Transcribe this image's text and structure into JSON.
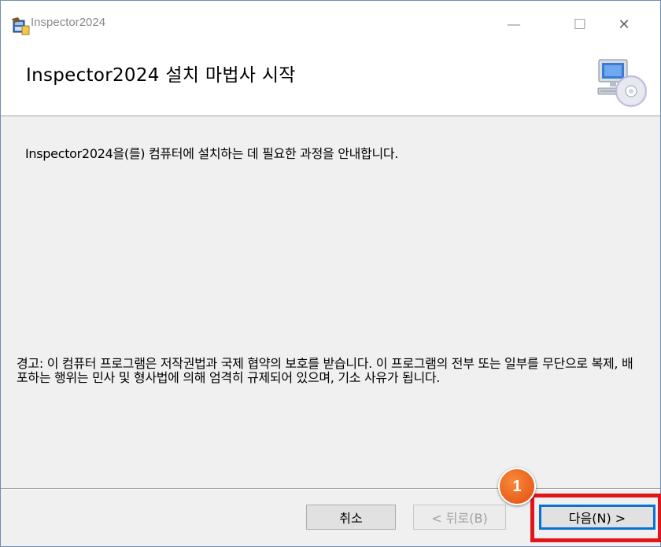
{
  "window": {
    "title": "Inspector2024",
    "minimize_glyph": "—",
    "maximize_glyph": "☐",
    "close_glyph": "✕"
  },
  "header": {
    "title": "Inspector2024 설치 마법사 시작",
    "icon": "computer-cd-icon"
  },
  "body": {
    "intro": "Inspector2024을(를) 컴퓨터에 설치하는 데 필요한 과정을 안내합니다.",
    "warning": "경고: 이 컴퓨터 프로그램은 저작권법과 국제 협약의 보호를 받습니다. 이 프로그램의 전부 또는 일부를 무단으로 복제, 배포하는 행위는 민사 및 형사법에 의해 엄격히 규제되어 있으며, 기소 사유가 됩니다."
  },
  "buttons": {
    "cancel": "취소",
    "back": "< 뒤로(B)",
    "next": "다음(N) >"
  },
  "annotation": {
    "step_number": "1",
    "highlight_color": "#e0161b",
    "badge_color": "#e85a1a"
  },
  "icons": {
    "app": "installer-package-icon"
  }
}
